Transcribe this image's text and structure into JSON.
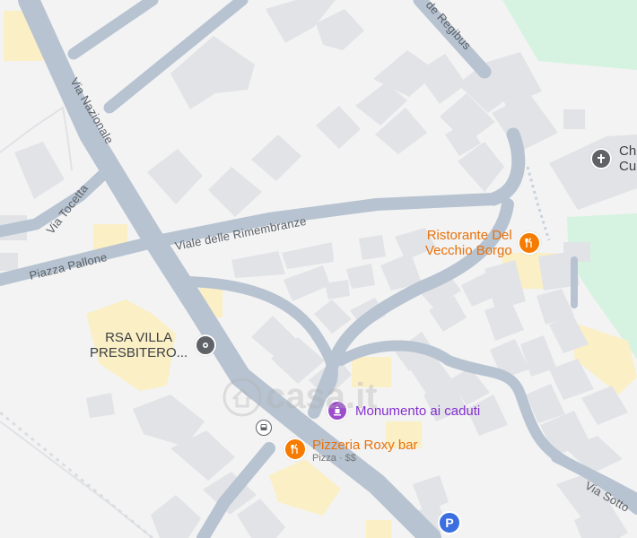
{
  "streets": {
    "via_nazionale": "Via Nazionale",
    "via_tocetta": "Via Tocetta",
    "piazza_pallone": "Piazza Pallone",
    "viale_rimembranze": "Viale delle Rimembranze",
    "de_regibus": "de Regibus",
    "via_sotto": "Via Sotto"
  },
  "pois": {
    "ristorante": {
      "line1": "Ristorante Del",
      "line2": "Vecchio Borgo",
      "icon": "fork-knife-icon",
      "color": "#f57c00"
    },
    "rsa": {
      "line1": "RSA VILLA",
      "line2": "PRESBITERO...",
      "icon": "place-pin-icon",
      "color": "#5f6368"
    },
    "monumento": {
      "name": "Monumento ai caduti",
      "icon": "monument-icon",
      "color": "#9c4dcc"
    },
    "pizzeria": {
      "name": "Pizzeria Roxy bar",
      "sub": "Pizza · $$",
      "icon": "fork-knife-icon",
      "color": "#f57c00"
    },
    "chiesa": {
      "line1": "Chi",
      "line2": "Cu",
      "icon": "cross-icon",
      "color": "#5f6368"
    }
  },
  "watermark": "casa.it",
  "colors": {
    "road": "#b7c3d1",
    "building": "#e2e3e7",
    "park": "#d5f3e0",
    "highlight": "#fbefc6"
  }
}
